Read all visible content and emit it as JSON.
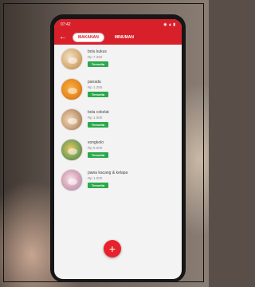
{
  "status_bar": {
    "time": "07:42",
    "icons": "◉ ▲ ▮"
  },
  "app_bar": {
    "back_icon": "arrow-left-icon",
    "tabs": [
      {
        "label": "MAKANAN",
        "active": true
      },
      {
        "label": "MINUMAN",
        "active": false
      }
    ]
  },
  "menu_items": [
    {
      "name": "bolu kukus",
      "price": "Rp 7.250",
      "status": "Tersedia"
    },
    {
      "name": "panada",
      "price": "Rp 1.250",
      "status": "Tersedia"
    },
    {
      "name": "bola cokelat",
      "price": "Rp 1.000",
      "status": "Tersedia"
    },
    {
      "name": "songkolo",
      "price": "Rp 5.000",
      "status": "Tersedia"
    },
    {
      "name": "pawa kacang & kelapa",
      "price": "Rp 1.000",
      "status": "Tersedia"
    }
  ],
  "fab": {
    "symbol": "+",
    "icon": "plus-icon"
  },
  "colors": {
    "primary": "#d8202a",
    "available": "#2aa94a",
    "background": "#f4f3f3"
  }
}
